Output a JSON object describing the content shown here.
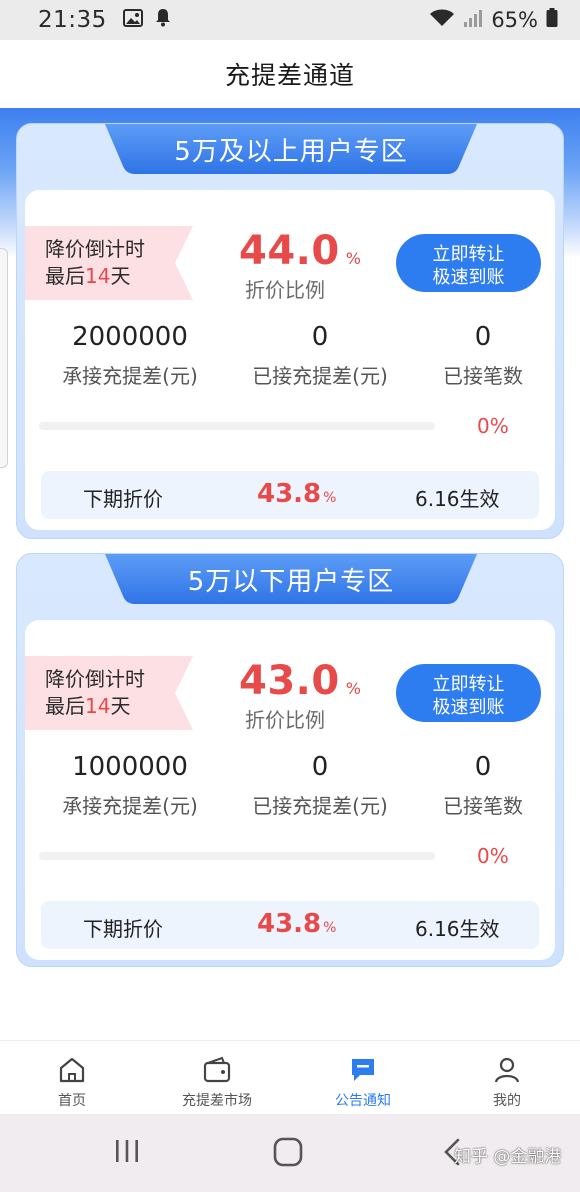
{
  "status_bar": {
    "time": "21:35",
    "battery": "65%",
    "icons": [
      "image-icon",
      "bell-icon",
      "wifi-icon",
      "signal-icon",
      "battery-icon"
    ]
  },
  "header": {
    "title": "充提差通道"
  },
  "zones": [
    {
      "title": "5万及以上用户专区",
      "ribbon_line1": "降价倒计时",
      "ribbon_prefix": "最后",
      "ribbon_days": "14",
      "ribbon_suffix": "天",
      "discount_value": "44.0",
      "discount_unit": "%",
      "discount_label": "折价比例",
      "cta_line1": "立即转让",
      "cta_line2": "极速到账",
      "stats": [
        {
          "value": "2000000",
          "label": "承接充提差(元)"
        },
        {
          "value": "0",
          "label": "已接充提差(元)"
        },
        {
          "value": "0",
          "label": "已接笔数"
        }
      ],
      "progress_percent": 0,
      "progress_text": "0%",
      "next_label": "下期折价",
      "next_value": "43.8",
      "next_unit": "%",
      "next_date": "6.16生效"
    },
    {
      "title": "5万以下用户专区",
      "ribbon_line1": "降价倒计时",
      "ribbon_prefix": "最后",
      "ribbon_days": "14",
      "ribbon_suffix": "天",
      "discount_value": "43.0",
      "discount_unit": "%",
      "discount_label": "折价比例",
      "cta_line1": "立即转让",
      "cta_line2": "极速到账",
      "stats": [
        {
          "value": "1000000",
          "label": "承接充提差(元)"
        },
        {
          "value": "0",
          "label": "已接充提差(元)"
        },
        {
          "value": "0",
          "label": "已接笔数"
        }
      ],
      "progress_percent": 0,
      "progress_text": "0%",
      "next_label": "下期折价",
      "next_value": "43.8",
      "next_unit": "%",
      "next_date": "6.16生效"
    }
  ],
  "bottom_nav": {
    "active": "notice",
    "items": [
      {
        "key": "home",
        "label": "首页",
        "icon": "home-icon"
      },
      {
        "key": "market",
        "label": "充提差市场",
        "icon": "wallet-icon"
      },
      {
        "key": "notice",
        "label": "公告通知",
        "icon": "message-icon"
      },
      {
        "key": "mine",
        "label": "我的",
        "icon": "user-icon"
      }
    ]
  },
  "watermark": "知乎 @金融港",
  "colors": {
    "accent": "#2e7df0",
    "highlight_red": "#e84a4a",
    "ribbon_pink": "#fde0e3",
    "zone_bg": "#d8e8fe"
  }
}
